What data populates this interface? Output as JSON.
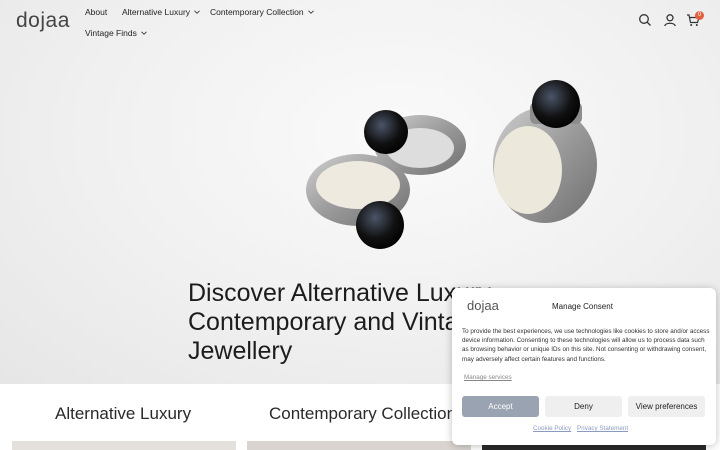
{
  "header": {
    "logo": "dojaa",
    "nav": [
      {
        "label": "About"
      },
      {
        "label": "Alternative Luxury"
      },
      {
        "label": "Contemporary Collection"
      },
      {
        "label": "Vintage Finds"
      }
    ],
    "icons": [
      "search-icon",
      "account-icon",
      "cart-icon"
    ],
    "cart_count": "0"
  },
  "hero": {
    "title": "Discover Alternative Luxury,\nContemporary and Vintage\nJewellery"
  },
  "collections": [
    {
      "title": "Alternative Luxury"
    },
    {
      "title": "Contemporary Collection"
    }
  ],
  "consent": {
    "logo": "dojaa",
    "heading": "Manage Consent",
    "body": "To provide the best experiences, we use technologies like cookies to store and/or access device information. Consenting to these technologies will allow us to process data such as browsing behavior or unique IDs on this site. Not consenting or withdrawing consent, may adversely affect certain features and functions.",
    "manage_link": "Manage services",
    "accept": "Accept",
    "deny": "Deny",
    "preferences": "View preferences",
    "cookie_policy": "Cookie Policy",
    "privacy": "Privacy Statement"
  },
  "colors": {
    "accent": "#9aa3b2",
    "badge": "#e3603f",
    "link": "#8a9bc2"
  }
}
